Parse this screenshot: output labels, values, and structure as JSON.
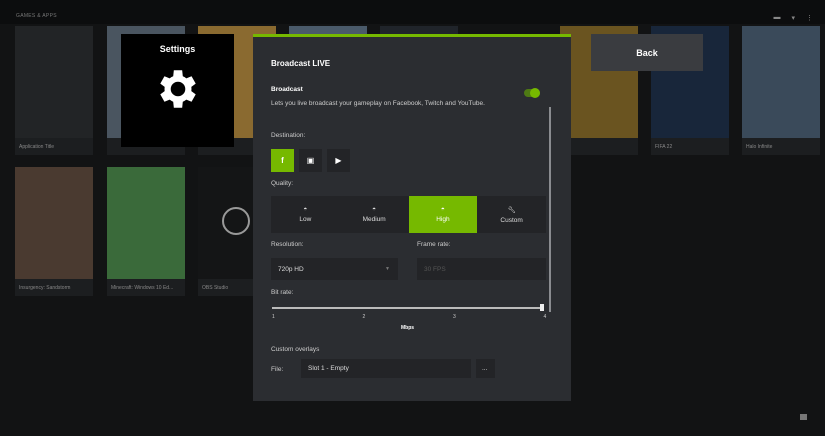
{
  "section_title": "GAMES & APPS",
  "tiles": [
    {
      "label": "Application Title",
      "color": "#222426"
    },
    {
      "label": "",
      "color": "#4a5560"
    },
    {
      "label": "",
      "color": "#8a6a30"
    },
    {
      "label": "",
      "color": "#4a5a6a"
    },
    {
      "label": "",
      "color": "#20242a"
    },
    {
      "label": "",
      "color": "#6a5420"
    },
    {
      "label": "FIFA 22",
      "color": "#18263a"
    },
    {
      "label": "Halo Infinite",
      "color": "#3a4a5a"
    },
    {
      "label": "Insurgency: Sandstorm",
      "color": "#4a3a30"
    },
    {
      "label": "Minecraft: Windows 10 Ed...",
      "color": "#3a6a3a"
    },
    {
      "label": "OBS Studio",
      "color": "#141516"
    }
  ],
  "settings": {
    "title": "Settings"
  },
  "back_label": "Back",
  "panel": {
    "title": "Broadcast LIVE",
    "broadcast_label": "Broadcast",
    "broadcast_desc": "Lets you live broadcast your gameplay on Facebook, Twitch and YouTube.",
    "broadcast_on": true,
    "destination_label": "Destination:",
    "quality_label": "Quality:",
    "quality": [
      "Low",
      "Medium",
      "High",
      "Custom"
    ],
    "quality_selected": "High",
    "resolution_label": "Resolution:",
    "resolution_value": "720p HD",
    "framerate_label": "Frame rate:",
    "framerate_value": "30 FPS",
    "bitrate_label": "Bit rate:",
    "bitrate_ticks": [
      "1",
      "2",
      "3",
      "4"
    ],
    "bitrate_value": 4,
    "bitrate_unit": "Mbps",
    "overlays_label": "Custom overlays",
    "file_label": "File:",
    "file_value": "Slot 1 - Empty",
    "browse_label": "..."
  },
  "accent": "#76b900"
}
